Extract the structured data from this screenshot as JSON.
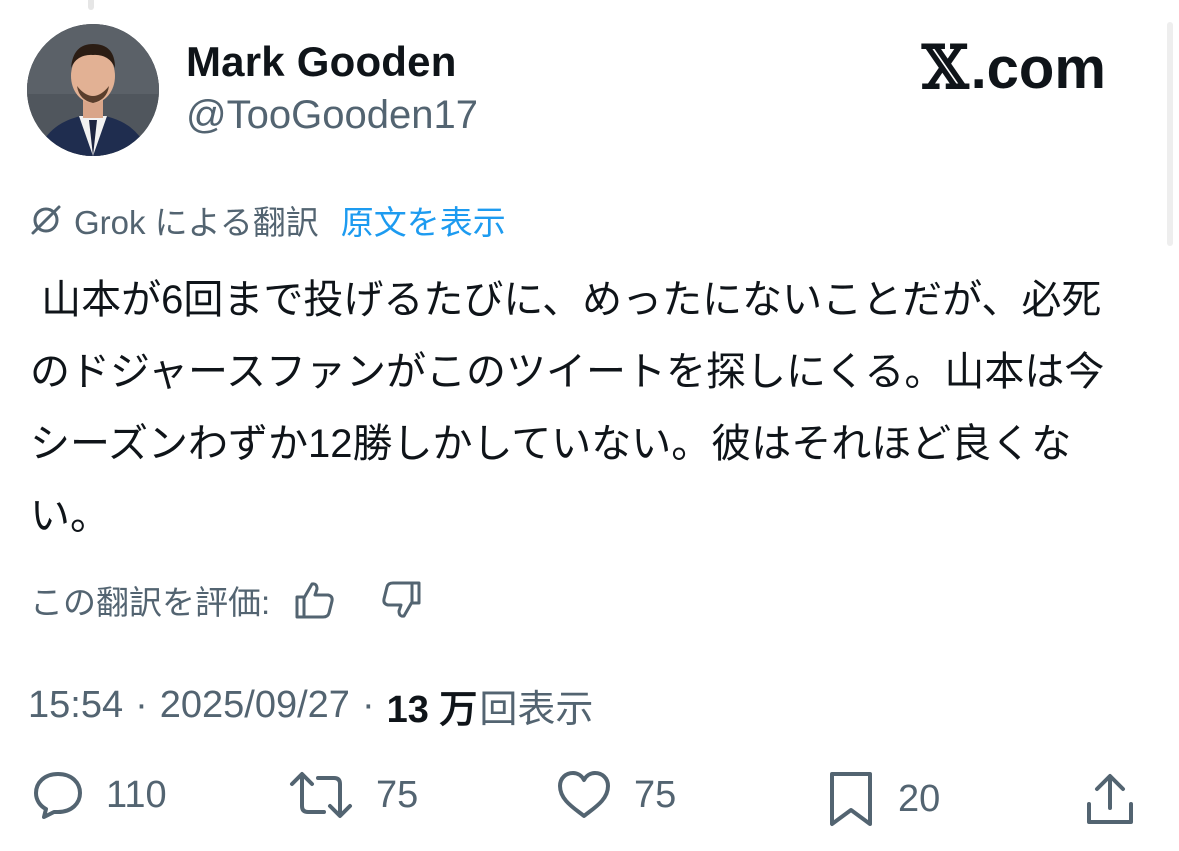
{
  "author": {
    "name": "Mark Gooden",
    "handle": "@TooGooden17"
  },
  "brand": {
    "logo_x": "𝕏",
    "logo_text": ".com"
  },
  "translation": {
    "label": "Grok による翻訳",
    "show_original": "原文を表示"
  },
  "tweet": {
    "text": " 山本が6回まで投げるたびに、めったにないことだが、必死のドジャースファンがこのツイートを探しにくる。山本は今シーズンわずか12勝しかしていない。彼はそれほど良くない。"
  },
  "rating": {
    "label": "この翻訳を評価:"
  },
  "meta": {
    "time": "15:54",
    "sep1": "·",
    "date": "2025/09/27",
    "sep2": "·",
    "views_count": "13 万",
    "views_label": "回表示"
  },
  "actions": {
    "replies": "110",
    "reposts": "75",
    "likes": "75",
    "bookmarks": "20"
  },
  "colors": {
    "text": "#0f1419",
    "secondary": "#536471",
    "link": "#1d9bf0"
  }
}
